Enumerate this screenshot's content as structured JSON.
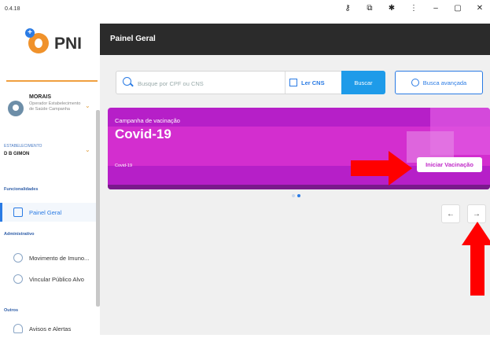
{
  "titlebar": {
    "version": "0.4.18"
  },
  "app": {
    "logo_text": "PNI"
  },
  "user": {
    "name": "MORAIS",
    "role": "Operador Estabelecimento de Saúde Campanha"
  },
  "establishment": {
    "label": "ESTABELECIMENTO",
    "value": "D B GIMON"
  },
  "sidebar": {
    "section_funcionalidades": "Funcionalidades",
    "painel_geral": "Painel Geral",
    "section_administrativo": "Administrativo",
    "movimento": "Movimento de Imuno...",
    "vincular": "Vincular Público Alvo",
    "section_outros": "Outros",
    "avisos": "Avisos e Alertas"
  },
  "header": {
    "title": "Painel Geral"
  },
  "search": {
    "placeholder": "Busque por CPF ou CNS",
    "ler_cns": "Ler CNS",
    "buscar": "Buscar",
    "busca_avancada": "Busca avançada"
  },
  "card": {
    "campaign_label": "Campanha de vacinação",
    "title": "Covid-19",
    "subtitle": "Covid-19",
    "button": "Iniciar Vacinação"
  },
  "pager": {
    "prev": "←",
    "next": "→"
  },
  "colors": {
    "accent": "#2a7be4",
    "card": "#b61fc8",
    "header": "#2b2b2b",
    "annotation": "#ff0000"
  }
}
